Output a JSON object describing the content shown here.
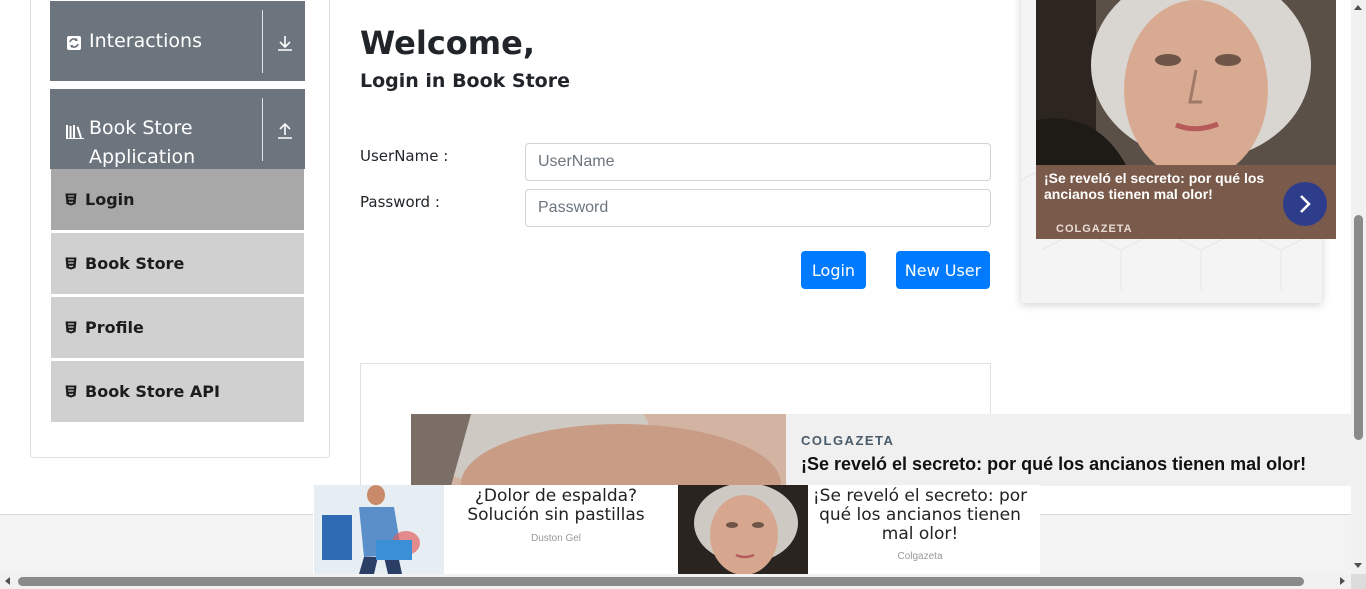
{
  "sidebar": {
    "groups": [
      {
        "label": "Interactions",
        "icon": "refresh-icon",
        "state_icon": "download-arrow-icon"
      },
      {
        "label_line1": "Book Store",
        "label_line2": "Application",
        "icon": "books-icon",
        "state_icon": "upload-arrow-icon"
      }
    ],
    "items": [
      {
        "label": "Login",
        "icon": "html5-icon",
        "active": true
      },
      {
        "label": "Book Store",
        "icon": "html5-icon",
        "active": false
      },
      {
        "label": "Profile",
        "icon": "html5-icon",
        "active": false
      },
      {
        "label": "Book Store API",
        "icon": "html5-icon",
        "active": false
      }
    ]
  },
  "main": {
    "heading": "Welcome,",
    "subheading": "Login in Book Store",
    "username_label": "UserName :",
    "username_placeholder": "UserName",
    "username_value": "",
    "password_label": "Password :",
    "password_placeholder": "Password",
    "password_value": "",
    "login_button": "Login",
    "new_user_button": "New User"
  },
  "ads": {
    "right": {
      "headline": "¡Se reveló el secreto: por qué los ancianos tienen mal olor!",
      "brand": "COLGAZETA",
      "caption_color": "#7a5a4a",
      "next_button_color": "#2e3c8c"
    },
    "sticky": {
      "brand": "COLGAZETA",
      "headline": "¡Se reveló el secreto: por qué los ancianos tienen mal olor!"
    },
    "bottom": [
      {
        "title": "¿Dolor de espalda? Solución sin pastillas",
        "source": "Duston Gel"
      },
      {
        "title": "¡Se reveló el secreto: por qué los ancianos tienen mal olor!",
        "source": "Colgazeta"
      }
    ]
  },
  "colors": {
    "accent": "#007bff",
    "group_header": "#6c757d",
    "menu_item": "#d0d0d0",
    "menu_item_active": "#a8a8a8"
  }
}
